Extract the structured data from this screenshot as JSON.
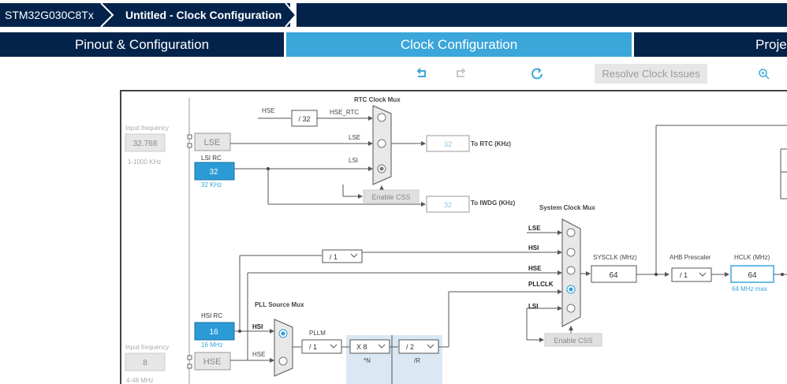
{
  "breadcrumb": {
    "device": "STM32G030C8Tx",
    "project": "Untitled - Clock Configuration"
  },
  "tabs": [
    {
      "label": "Pinout & Configuration",
      "active": false
    },
    {
      "label": "Clock Configuration",
      "active": true
    },
    {
      "label": "Proje",
      "active": false
    }
  ],
  "toolbar": {
    "resolve_label": "Resolve Clock Issues"
  },
  "left": {
    "input_freq_label": "Input frequency",
    "lse_input": "32.768",
    "lse_range": "1-1000 KHz",
    "hse_input_label": "Input frequency",
    "hse_input": "8",
    "hse_range": "4-48 MHz"
  },
  "osc": {
    "lse": "LSE",
    "lsi_rc_label": "LSI RC",
    "lsi_value": "32",
    "lsi_unit": "32 KHz",
    "hsi_rc_label": "HSI RC",
    "hsi_value": "16",
    "hsi_unit": "16 MHz",
    "hse": "HSE"
  },
  "rtc": {
    "mux_title": "RTC Clock Mux",
    "hse_label": "HSE",
    "div32": "/ 32",
    "hse_rtc_label": "HSE_RTC",
    "lse_label": "LSE",
    "lsi_label": "LSI",
    "enable_css": "Enable CSS",
    "to_rtc_value": "32",
    "to_rtc_label": "To RTC (KHz)",
    "to_iwdg_value": "32",
    "to_iwdg_label": "To IWDG (KHz)"
  },
  "sys": {
    "mux_title": "System Clock Mux",
    "lse": "LSE",
    "hsi": "HSI",
    "hse": "HSE",
    "pllclk": "PLLCLK",
    "lsi": "LSI",
    "hsi_div": "/ 1",
    "enable_css": "Enable CSS",
    "sysclk_label": "SYSCLK (MHz)",
    "sysclk_value": "64",
    "ahb_label": "AHB Prescaler",
    "ahb_value": "/ 1",
    "hclk_label": "HCLK (MHz)",
    "hclk_value": "64",
    "hclk_max": "64 MHz max"
  },
  "pll": {
    "mux_title": "PLL Source Mux",
    "hsi": "HSI",
    "hse": "HSE",
    "pllm_label": "PLLM",
    "pllm_value": "/ 1",
    "n_value": "X 8",
    "n_label": "*N",
    "r_value": "/ 2",
    "r_label": "/R"
  },
  "colors": {
    "navy": "#03234b",
    "accent": "#3ba6da",
    "selected": "#2b9bd6"
  }
}
